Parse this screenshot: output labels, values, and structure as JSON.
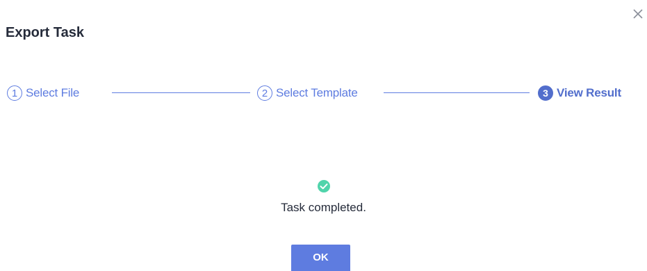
{
  "dialog": {
    "title": "Export Task",
    "close_icon": "close-icon"
  },
  "steps": [
    {
      "number": "1",
      "label": "Select File",
      "state": "completed"
    },
    {
      "number": "2",
      "label": "Select Template",
      "state": "completed"
    },
    {
      "number": "3",
      "label": "View Result",
      "state": "active"
    }
  ],
  "result": {
    "icon": "check-circle-icon",
    "message": "Task completed."
  },
  "actions": {
    "ok_label": "OK"
  },
  "colors": {
    "accent": "#5e7ce0",
    "accent_active": "#526ecc",
    "success": "#50d4ab"
  }
}
